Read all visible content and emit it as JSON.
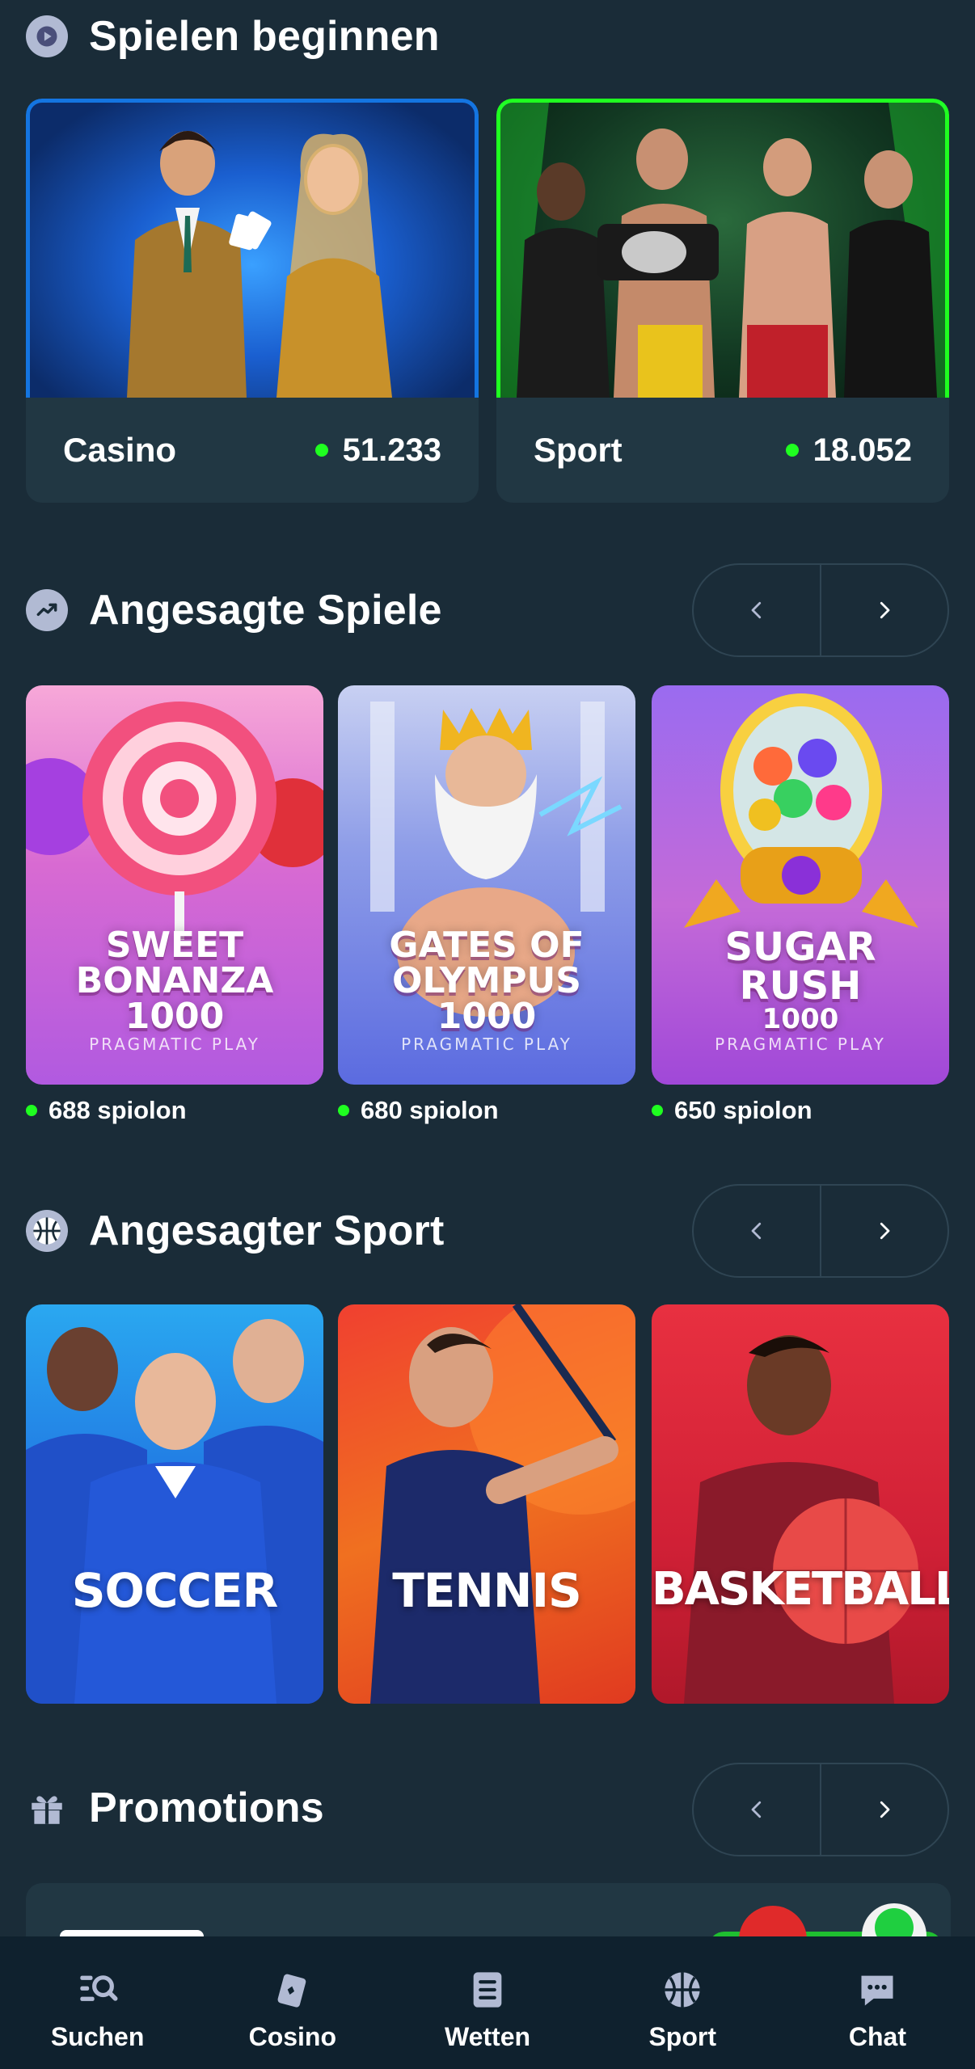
{
  "sections": {
    "start": {
      "title": "Spielen beginnen"
    },
    "trending_games": {
      "title": "Angesagte Spiele"
    },
    "trending_sports": {
      "title": "Angesagter Sport"
    },
    "promotions": {
      "title": "Promotions"
    }
  },
  "start_cards": [
    {
      "name": "Casino",
      "count": "51.233",
      "border": "#1475e1"
    },
    {
      "name": "Sport",
      "count": "18.052",
      "border": "#1fff20"
    }
  ],
  "games": [
    {
      "title_lines": [
        "SWEET",
        "BONANZA",
        "1000"
      ],
      "provider": "PRAGMATIC PLAY",
      "players": "688 spiolon"
    },
    {
      "title_lines": [
        "GATES OF",
        "OLYMPUS",
        "1000"
      ],
      "provider": "PRAGMATIC PLAY",
      "players": "680 spiolon"
    },
    {
      "title_lines": [
        "SUGAR",
        "RUSH",
        "1000"
      ],
      "provider": "PRAGMATIC PLAY",
      "players": "650 spiolon"
    }
  ],
  "sports": [
    {
      "title": "SOCCER"
    },
    {
      "title": "TENNIS"
    },
    {
      "title": "BASKETBALL"
    }
  ],
  "bottom_nav": [
    {
      "label": "Suchen",
      "icon": "search-list-icon"
    },
    {
      "label": "Cosino",
      "icon": "cards-icon"
    },
    {
      "label": "Wetten",
      "icon": "betslip-icon"
    },
    {
      "label": "Sport",
      "icon": "basketball-icon"
    },
    {
      "label": "Chat",
      "icon": "chat-icon"
    }
  ],
  "colors": {
    "background": "#1a2c38",
    "card": "#213743",
    "nav_bg": "#0f212e",
    "online_dot": "#1fff20",
    "accent_blue": "#1475e1"
  }
}
